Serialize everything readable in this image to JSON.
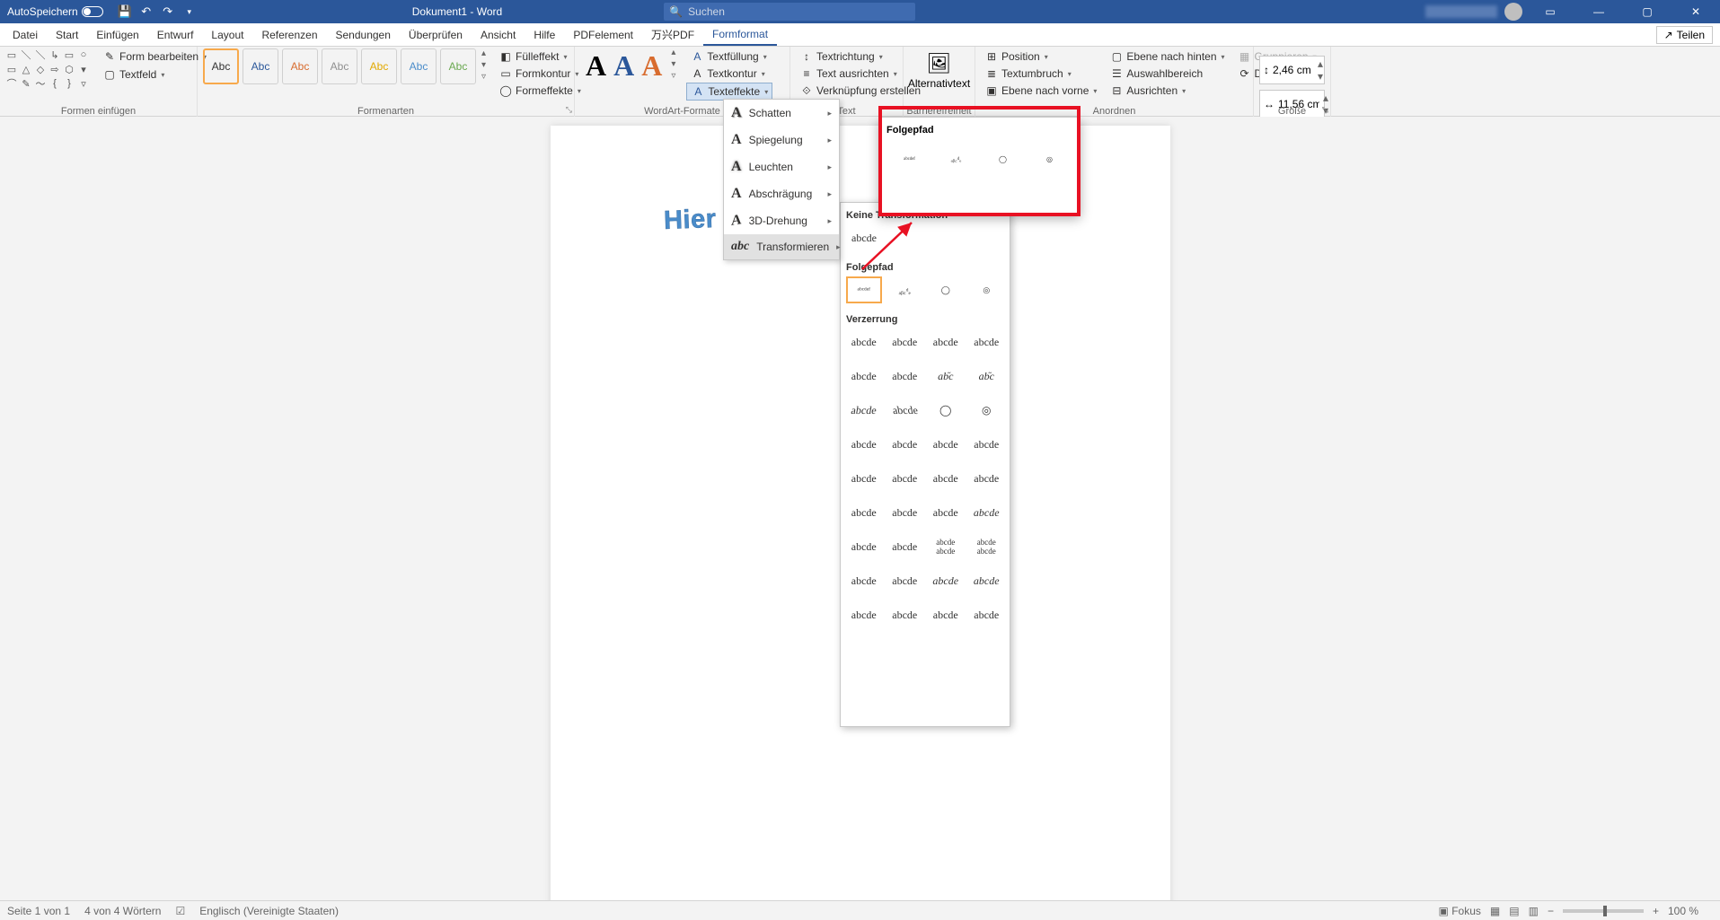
{
  "titlebar": {
    "autosave": "AutoSpeichern",
    "title": "Dokument1 - Word",
    "search_placeholder": "Suchen"
  },
  "menu": {
    "tabs": [
      "Datei",
      "Start",
      "Einfügen",
      "Entwurf",
      "Layout",
      "Referenzen",
      "Sendungen",
      "Überprüfen",
      "Ansicht",
      "Hilfe",
      "PDFelement",
      "万兴PDF",
      "Formformat"
    ],
    "active": 12,
    "share": "Teilen"
  },
  "ribbon": {
    "shapes_group": "Formen einfügen",
    "form_bearbeiten": "Form bearbeiten",
    "textfeld": "Textfeld",
    "styles_group": "Formenarten",
    "style_label": "Abc",
    "fuellfarbe": "Fülleffekt",
    "formkontur": "Formkontur",
    "formeffekte": "Formeffekte",
    "wordart_group": "WordArt-Formate",
    "textfuellung": "Textfüllung",
    "textkontur": "Textkontur",
    "texteffekte": "Texteffekte",
    "text_group": "Text",
    "textrichtung": "Textrichtung",
    "text_ausrichten": "Text ausrichten",
    "verknuepfung": "Verknüpfung erstellen",
    "alt_group": "Barrierefreiheit",
    "alttext": "Alternativtext",
    "arrange_group": "Anordnen",
    "position": "Position",
    "textumbruch": "Textumbruch",
    "nach_vorne": "Ebene nach vorne",
    "nach_hinten": "Ebene nach hinten",
    "auswahlbereich": "Auswahlbereich",
    "ausrichten": "Ausrichten",
    "gruppieren": "Gruppieren",
    "drehen": "Drehen",
    "size_group": "Größe",
    "height": "2,46 cm",
    "width": "11,56 cm"
  },
  "document": {
    "wordart_text": "Hier steht Ihr Te"
  },
  "fx_menu": {
    "items": [
      "Schatten",
      "Spiegelung",
      "Leuchten",
      "Abschrägung",
      "3D-Drehung",
      "Transformieren"
    ],
    "active": 5
  },
  "transform": {
    "none_title": "Keine Transformation",
    "none_sample": "abcde",
    "path_title": "Folgepfad",
    "warp_title": "Verzerrung",
    "sample": "abcde"
  },
  "tooltip": {
    "title": "Folgepfad"
  },
  "status": {
    "page": "Seite 1 von 1",
    "words": "4 von 4 Wörtern",
    "lang": "Englisch (Vereinigte Staaten)",
    "fokus": "Fokus",
    "zoom": "100 %"
  }
}
